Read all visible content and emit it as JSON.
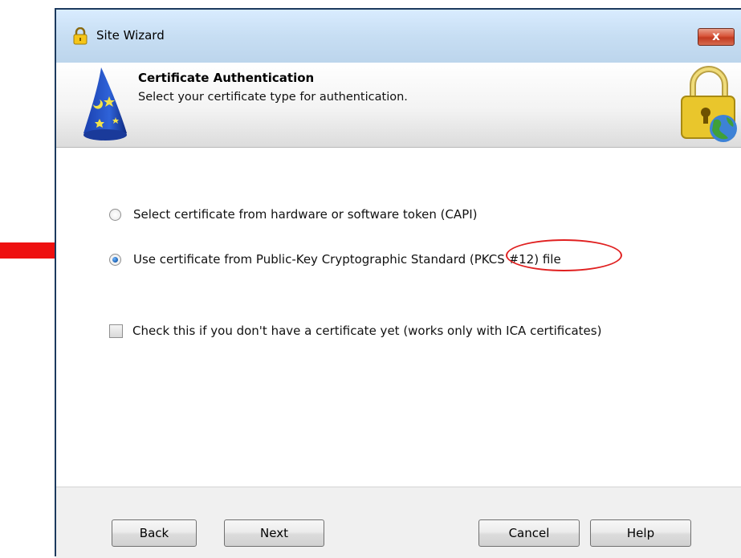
{
  "window": {
    "title": "Site Wizard",
    "close_label": "x"
  },
  "header": {
    "title": "Certificate Authentication",
    "subtitle": "Select your certificate type for authentication."
  },
  "options": {
    "radio_capi": {
      "label": "Select certificate from hardware or software token (CAPI)",
      "checked": false
    },
    "radio_pkcs12": {
      "label_prefix": "Use certificate from Public-Key Cryptographic Standard ",
      "label_highlight": "(PKCS #12) file",
      "checked": true
    },
    "no_certificate_checkbox": {
      "label": "Check this if you don't have a certificate yet (works only with ICA certificates)",
      "checked": false
    }
  },
  "buttons": {
    "back": "Back",
    "next": "Next",
    "cancel": "Cancel",
    "help": "Help"
  },
  "colors": {
    "annotation": "#e02020",
    "accent": "#1b5fb0"
  }
}
